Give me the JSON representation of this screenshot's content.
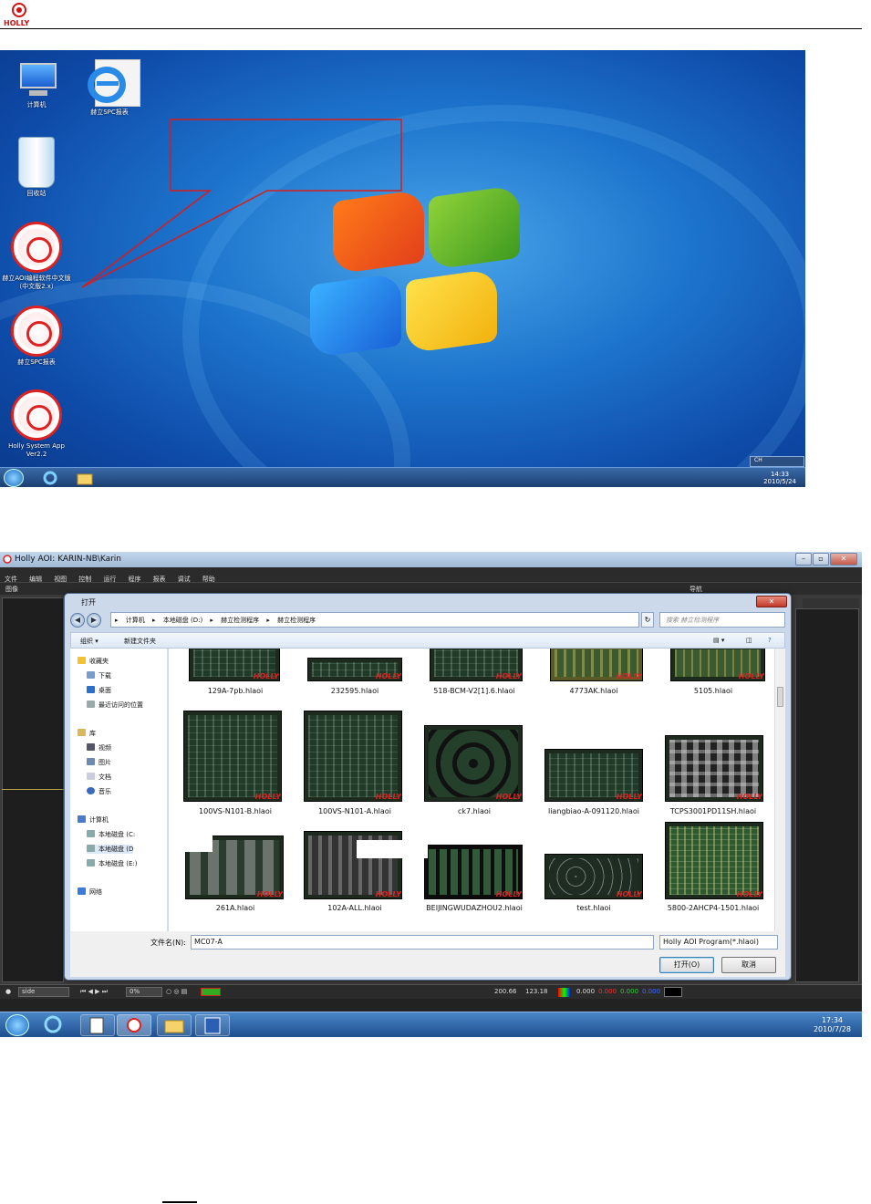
{
  "header": {
    "logo_text": "HOLLY"
  },
  "desktop": {
    "icons": [
      {
        "label": "计算机",
        "icon": "computer-icon"
      },
      {
        "label": "赫立SPC报表",
        "icon": "ie-icon"
      },
      {
        "label": "回收站",
        "icon": "recycle-bin-icon"
      },
      {
        "label": "赫立AOI编程软件中文版（中文版2.x）",
        "icon": "holly-lion-icon"
      },
      {
        "label": "赫立SPC报表",
        "icon": "holly-lion-icon"
      },
      {
        "label": "Holly System App Ver2.2",
        "icon": "holly-lion-icon"
      }
    ],
    "language_bar": "CH",
    "clock": {
      "time": "14:33",
      "date": "2010/5/24"
    }
  },
  "app": {
    "title": "Holly AOI: KARIN-NB\\Karin",
    "menus": [
      "文件",
      "编辑",
      "视图",
      "控制",
      "运行",
      "程序",
      "报表",
      "调试",
      "帮助"
    ],
    "subbar_left": "图像",
    "subbar_right": "导航",
    "bottom": {
      "side": "side",
      "zoom": "0%",
      "coord_x": "200.66",
      "coord_y": "123.18",
      "rgb_r": "0.000",
      "rgb_g": "0.000",
      "rgb_b": "0.000",
      "rgb_extra": "0.000"
    },
    "clock": {
      "time": "17:34",
      "date": "2010/7/28"
    }
  },
  "dialog": {
    "title": "打开",
    "close": "✕",
    "path": [
      "计算机",
      "本地磁盘 (D:)",
      "赫立检测程序",
      "赫立检测程序"
    ],
    "search_placeholder": "搜索 赫立检测程序",
    "toolbar": {
      "organize": "组织 ▾",
      "new_folder": "新建文件夹"
    },
    "nav": {
      "favorites": "收藏夹",
      "downloads": "下载",
      "desktop": "桌面",
      "recent": "最近访问的位置",
      "libraries": "库",
      "videos": "视频",
      "pictures": "图片",
      "documents": "文档",
      "music": "音乐",
      "computer": "计算机",
      "disk_c": "本地磁盘 (C:",
      "disk_d": "本地磁盘 (D",
      "disk_e": "本地磁盘 (E:)",
      "network": "网络"
    },
    "files": [
      "129A-7pb.hlaoi",
      "232595.hlaoi",
      "518-BCM-V2[1].6.hlaoi",
      "4773AK.hlaoi",
      "5105.hlaoi",
      "100VS-N101-B.hlaoi",
      "100VS-N101-A.hlaoi",
      "ck7.hlaoi",
      "liangbiao-A-091120.hlaoi",
      "TCPS3001PD11SH.hlaoi",
      "261A.hlaoi",
      "102A-ALL.hlaoi",
      "BEIJINGWUDAZHOU2.hlaoi",
      "test.hlaoi",
      "5800-2AHCP4-1501.hlaoi"
    ],
    "thumb_mark": "HOLLY",
    "filename_label": "文件名(N):",
    "filename_value": "MC07-A",
    "filter": "Holly AOI Program(*.hlaoi)",
    "open_button": "打开(O)",
    "cancel_button": "取消"
  }
}
